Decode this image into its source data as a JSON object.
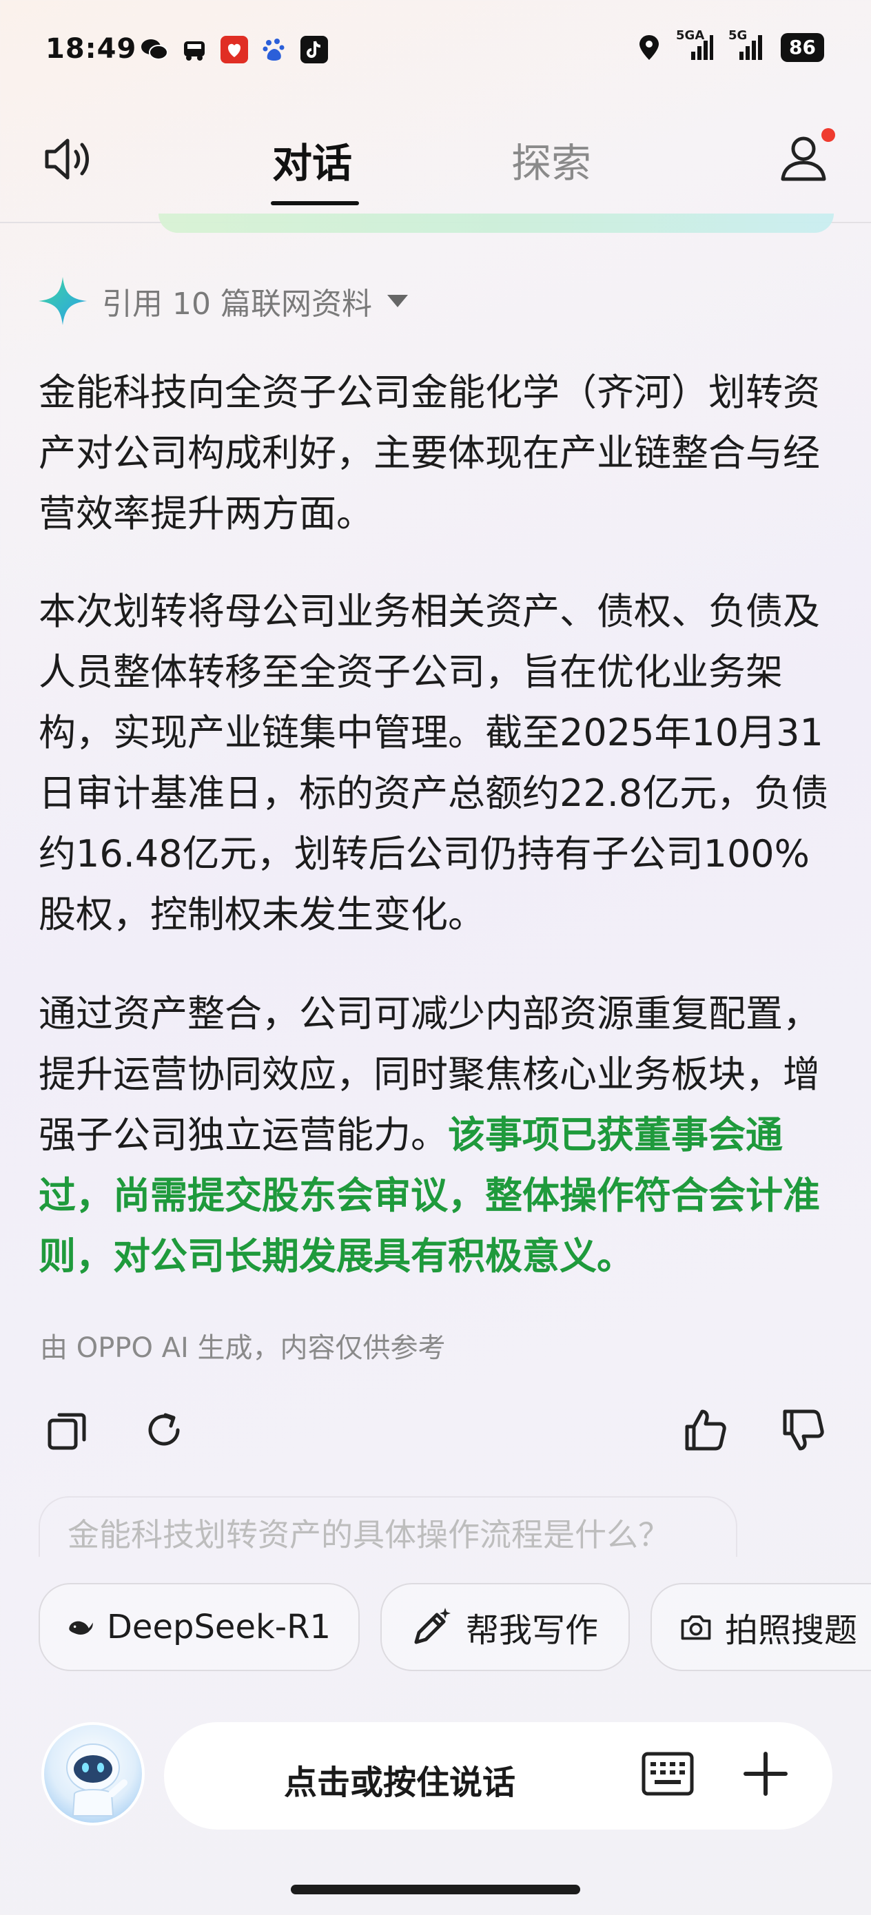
{
  "status_bar": {
    "time": "18:49",
    "left_icons": [
      "wechat-icon",
      "taxi-icon",
      "pinduoduo-icon",
      "baidu-icon",
      "tiktok-icon"
    ],
    "network_1": "5GA",
    "network_2": "5G",
    "battery": "86"
  },
  "header": {
    "tabs": [
      {
        "label": "对话",
        "active": true
      },
      {
        "label": "探索",
        "active": false
      }
    ]
  },
  "answer": {
    "reference_label": "引用 10 篇联网资料",
    "paragraphs": [
      "金能科技向全资子公司金能化学（齐河）划转资产对公司构成利好，主要体现在产业链整合与经营效率提升两方面。",
      "本次划转将母公司业务相关资产、债权、负债及人员整体转移至全资子公司，旨在优化业务架构，实现产业链集中管理。截至2025年10月31日审计基准日，标的资产总额约22.8亿元，负债约16.48亿元，划转后公司仍持有子公司100%股权，控制权未发生变化。"
    ],
    "p3_normal": "通过资产整合，公司可减少内部资源重复配置，提升运营协同效应，同时聚焦核心业务板块，增强子公司独立运营能力。",
    "p3_highlight": "该事项已获董事会通过，尚需提交股东会审议，整体操作符合会计准则，对公司长期发展具有积极意义。",
    "disclaimer": "由 OPPO AI 生成，内容仅供参考"
  },
  "suggestion": "金能科技划转资产的具体操作流程是什么？",
  "chips": [
    {
      "label": "DeepSeek-R1",
      "icon": "whale-icon"
    },
    {
      "label": "帮我写作",
      "icon": "pen-sparkle-icon"
    },
    {
      "label": "拍照搜题",
      "icon": "camera-icon"
    }
  ],
  "input": {
    "prompt": "点击或按住说话"
  },
  "colors": {
    "highlight_green": "#1f9a3c",
    "notification_red": "#ef3b2f"
  }
}
